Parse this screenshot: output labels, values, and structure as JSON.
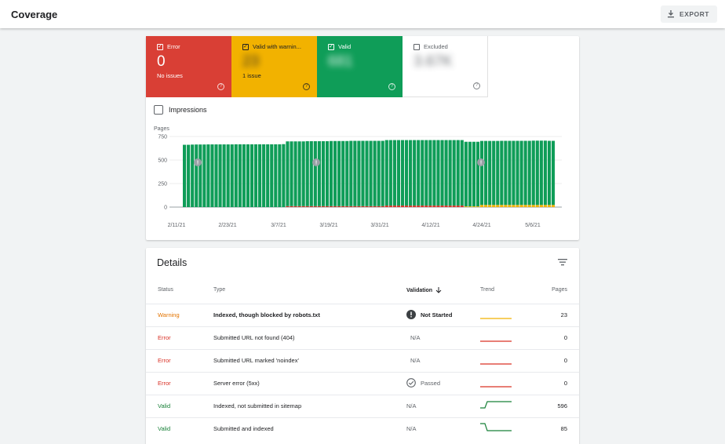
{
  "header": {
    "title": "Coverage",
    "export_label": "EXPORT"
  },
  "tiles": [
    {
      "label": "Error",
      "value": "0",
      "sub": "No issues",
      "checked": true
    },
    {
      "label": "Valid with warnin...",
      "value": "23",
      "sub": "1 issue",
      "checked": true
    },
    {
      "label": "Valid",
      "value": "681",
      "sub": "",
      "checked": true
    },
    {
      "label": "Excluded",
      "value": "3.67K",
      "sub": "",
      "checked": false
    }
  ],
  "impressions_label": "Impressions",
  "chart_data": {
    "type": "bar",
    "ylabel": "Pages",
    "yticks": [
      0,
      250,
      500,
      750
    ],
    "ylim": [
      0,
      750
    ],
    "xtick_labels": [
      "2/11/21",
      "2/23/21",
      "3/7/21",
      "3/19/21",
      "3/31/21",
      "4/12/21",
      "4/24/21",
      "5/6/21"
    ],
    "annotation_markers": [
      "!",
      "!",
      "!"
    ],
    "series": [
      {
        "name": "Valid",
        "color": "#0f9d58",
        "values": [
          662,
          662,
          664,
          665,
          665,
          665,
          666,
          666,
          666,
          666,
          666,
          666,
          666,
          667,
          667,
          667,
          667,
          667,
          667,
          667,
          667,
          667,
          667,
          667,
          667,
          669,
          688,
          688,
          688,
          688,
          688,
          690,
          690,
          690,
          690,
          690,
          690,
          692,
          692,
          692,
          692,
          692,
          694,
          694,
          694,
          694,
          694,
          694,
          694,
          694,
          694,
          696,
          696,
          696,
          696,
          696,
          696,
          696,
          696,
          696,
          696,
          696,
          696,
          696,
          696,
          696,
          696,
          696,
          696,
          696,
          696,
          686,
          686,
          686,
          686,
          680,
          680,
          680,
          680,
          680,
          681,
          681,
          681,
          681,
          681,
          681,
          681,
          681,
          683,
          683,
          683,
          683,
          681,
          681
        ]
      },
      {
        "name": "Error",
        "color": "#d93025",
        "values": [
          0,
          0,
          0,
          0,
          0,
          0,
          0,
          0,
          0,
          0,
          0,
          0,
          0,
          0,
          0,
          0,
          0,
          0,
          0,
          0,
          0,
          0,
          0,
          0,
          0,
          0,
          10,
          10,
          10,
          10,
          10,
          10,
          10,
          10,
          10,
          10,
          10,
          10,
          10,
          10,
          10,
          10,
          10,
          10,
          10,
          10,
          10,
          10,
          10,
          10,
          10,
          16,
          16,
          16,
          16,
          16,
          16,
          16,
          16,
          16,
          16,
          16,
          16,
          16,
          16,
          16,
          16,
          16,
          16,
          16,
          16,
          0,
          0,
          0,
          0,
          0,
          0,
          0,
          0,
          0,
          0,
          0,
          0,
          0,
          0,
          0,
          0,
          0,
          0,
          0,
          0,
          0,
          0,
          0
        ]
      },
      {
        "name": "Valid with warnings",
        "color": "#f2b200",
        "values": [
          0,
          0,
          0,
          0,
          0,
          0,
          0,
          0,
          0,
          0,
          0,
          0,
          0,
          0,
          0,
          0,
          0,
          0,
          0,
          0,
          0,
          0,
          0,
          0,
          0,
          0,
          0,
          0,
          0,
          0,
          0,
          0,
          0,
          0,
          0,
          0,
          0,
          0,
          0,
          0,
          0,
          0,
          0,
          0,
          0,
          0,
          0,
          0,
          0,
          0,
          0,
          0,
          0,
          0,
          0,
          0,
          0,
          0,
          0,
          0,
          0,
          0,
          0,
          0,
          0,
          0,
          0,
          0,
          0,
          0,
          0,
          8,
          8,
          8,
          8,
          23,
          23,
          23,
          23,
          23,
          23,
          23,
          23,
          23,
          23,
          23,
          23,
          23,
          23,
          23,
          23,
          23,
          23,
          23
        ]
      }
    ]
  },
  "details": {
    "title": "Details",
    "columns": {
      "status": "Status",
      "type": "Type",
      "validation": "Validation",
      "trend": "Trend",
      "pages": "Pages"
    },
    "rows": [
      {
        "status": "Warning",
        "type": "Indexed, though blocked by robots.txt",
        "validation": "Not Started",
        "pages": "23",
        "trend_color": "#f2b200"
      },
      {
        "status": "Error",
        "type": "Submitted URL not found (404)",
        "validation": "N/A",
        "pages": "0",
        "trend_color": "#d93025"
      },
      {
        "status": "Error",
        "type": "Submitted URL marked 'noindex'",
        "validation": "N/A",
        "pages": "0",
        "trend_color": "#d93025"
      },
      {
        "status": "Error",
        "type": "Server error (5xx)",
        "validation": "Passed",
        "pages": "0",
        "trend_color": "#d93025"
      },
      {
        "status": "Valid",
        "type": "Indexed, not submitted in sitemap",
        "validation": "N/A",
        "pages": "596",
        "trend_color": "#188038"
      },
      {
        "status": "Valid",
        "type": "Submitted and indexed",
        "validation": "N/A",
        "pages": "85",
        "trend_color": "#188038"
      }
    ]
  }
}
